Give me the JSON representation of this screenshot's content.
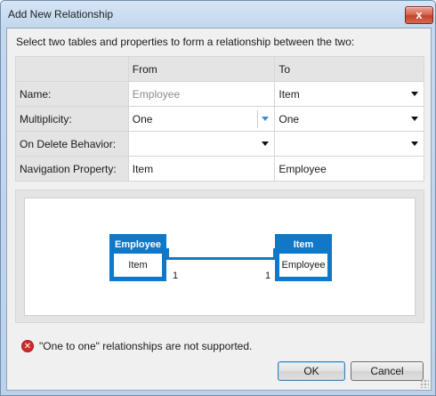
{
  "window": {
    "title": "Add New Relationship",
    "close_glyph": "x"
  },
  "intro": "Select two tables and properties to form a relationship between the two:",
  "grid": {
    "headers": {
      "label": "",
      "from": "From",
      "to": "To"
    },
    "rows": [
      {
        "label": "Name:",
        "from": "Employee",
        "to": "Item"
      },
      {
        "label": "Multiplicity:",
        "from": "One",
        "to": "One"
      },
      {
        "label": "On Delete Behavior:",
        "from": "",
        "to": ""
      },
      {
        "label": "Navigation Property:",
        "from": "Item",
        "to": "Employee"
      }
    ]
  },
  "diagram": {
    "left_entity": {
      "name": "Employee",
      "property": "Item",
      "multiplicity": "1"
    },
    "right_entity": {
      "name": "Item",
      "property": "Employee",
      "multiplicity": "1"
    }
  },
  "error": {
    "icon": "error-icon",
    "message": "\"One to one\" relationships are not supported."
  },
  "buttons": {
    "ok": "OK",
    "cancel": "Cancel"
  },
  "colors": {
    "accent": "#0f78c8",
    "error": "#d02b2b"
  }
}
